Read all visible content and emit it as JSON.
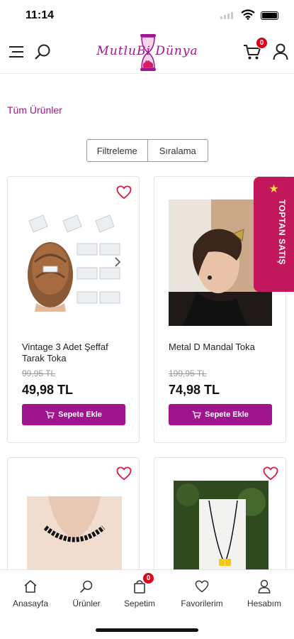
{
  "status": {
    "time": "11:14"
  },
  "header": {
    "logo_text": "MutluBi Dünya",
    "cart_count": "0",
    "icons": [
      "menu-icon",
      "search-icon",
      "cart-icon",
      "user-icon"
    ]
  },
  "breadcrumb": "Tüm Ürünler",
  "toolbar": {
    "filter_label": "Filtreleme",
    "sort_label": "Sıralama"
  },
  "wholesale_tab": "TOPTAN SATIŞ",
  "products": [
    {
      "name": "Vintage 3 Adet Şeffaf Tarak Toka",
      "old_price": "99,95 TL",
      "price": "49,98 TL",
      "button": "Sepete Ekle"
    },
    {
      "name": "Metal D Mandal Toka",
      "old_price": "199,95 TL",
      "price": "74,98 TL",
      "button": "Sepete Ekle"
    },
    {
      "name": "",
      "old_price": "",
      "price": "",
      "button": ""
    },
    {
      "name": "",
      "old_price": "",
      "price": "",
      "button": ""
    }
  ],
  "bottom_nav": {
    "items": [
      {
        "label": "Anasayfa",
        "icon": "home-icon"
      },
      {
        "label": "Ürünler",
        "icon": "search-icon"
      },
      {
        "label": "Sepetim",
        "icon": "bag-icon",
        "badge": "0"
      },
      {
        "label": "Favorilerim",
        "icon": "heart-icon"
      },
      {
        "label": "Hesabım",
        "icon": "user-icon"
      }
    ]
  },
  "colors": {
    "brand": "#a0148f",
    "badge": "#e0001a",
    "wholesale": "#c2185b",
    "heart": "#d81b3a"
  }
}
